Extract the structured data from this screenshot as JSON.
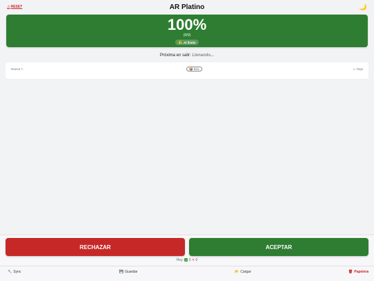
{
  "header": {
    "reset_label": "RESET",
    "reset_icon": "⚠",
    "title": "AR Platino",
    "theme_icon": "🌙"
  },
  "status": {
    "percent": "100%",
    "count": "(0/0)",
    "limit_icon": "⚠️",
    "limit_label": "Al límite",
    "bg_color": "#2e7d32"
  },
  "next": {
    "label": "Próxima en salir:",
    "value": "Llenando..."
  },
  "queue": {
    "newest_label": "Nueva ↖",
    "box_label": "📦 Box",
    "oldest_label": "↘ Vieja"
  },
  "actions": {
    "reject_label": "RECHAZAR",
    "accept_label": "ACEPTAR",
    "reject_color": "#c62828",
    "accept_color": "#2e7d32"
  },
  "today": {
    "label": "Hoy:",
    "accepted_icon": "✓",
    "accepted": "0",
    "rejected_icon": "✕",
    "rejected": "0"
  },
  "nav": {
    "sync_icon": "🔧",
    "sync_label": "Sync",
    "save_icon": "💾",
    "save_label": "Guardar",
    "load_icon": "📂",
    "load_label": "Cargar",
    "trash_icon": "🗑",
    "trash_label": "Papelera"
  }
}
